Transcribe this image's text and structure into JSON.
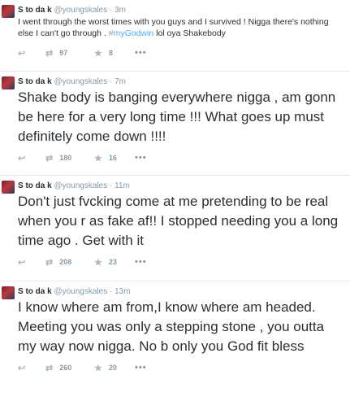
{
  "tweets": [
    {
      "name": "S to da k",
      "handle": "@youngskales",
      "time": "3m",
      "text_before": "I went through the worst times with you guys and I survived ! Nigga there's nothing else I can't go through . ",
      "hashtag": "#myGodwin",
      "text_after": " lol oya Shakebody",
      "retweets": "97",
      "favorites": "8"
    },
    {
      "name": "S to da k",
      "handle": "@youngskales",
      "time": "7m",
      "text": "Shake body is banging everywhere nigga , am gonn be here for a very long time !!! What goes up must definitely come down !!!!",
      "retweets": "180",
      "favorites": "16"
    },
    {
      "name": "S to da k",
      "handle": "@youngskales",
      "time": "11m",
      "text": "Don't just fvcking come at me pretending to be real when you r as fake af!!  I stopped needing you a long time ago . Get with it",
      "retweets": "208",
      "favorites": "23"
    },
    {
      "name": "S to da k",
      "handle": "@youngskales",
      "time": "13m",
      "text": "I know where am from,I know where am headed. Meeting you was only a stepping stone , you outta my way now nigga. No b only you God fit bless",
      "retweets": "260",
      "favorites": "20"
    }
  ],
  "separator": "·",
  "icons": {
    "reply": "reply-arrow-icon",
    "retweet": "retweet-icon",
    "favorite": "star-icon",
    "more": "more-dots-icon"
  },
  "colors": {
    "link": "#55acee",
    "meta": "#8899a6",
    "text": "#292f33",
    "border": "#e1e8ed"
  }
}
